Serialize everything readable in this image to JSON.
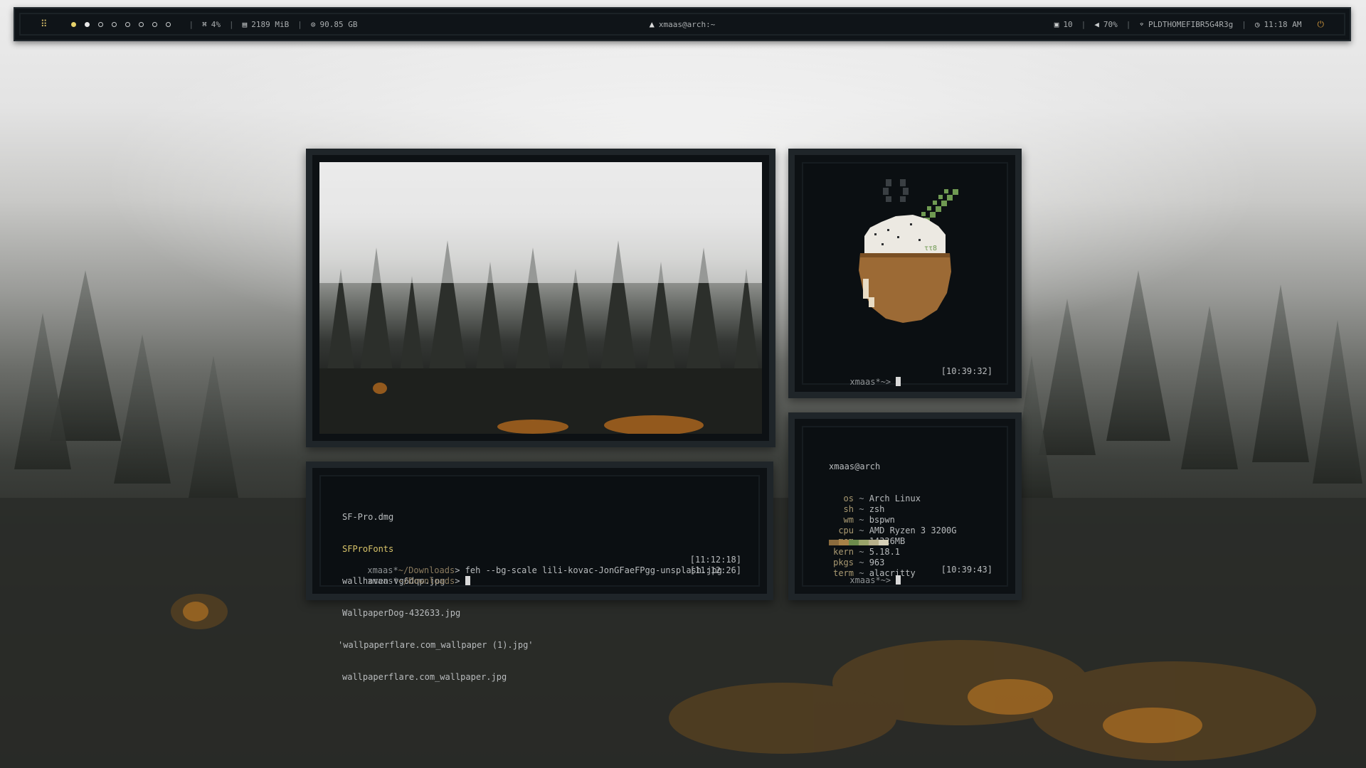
{
  "bar": {
    "launcher_icon": "grid-icon",
    "workspaces": [
      {
        "state": "focused"
      },
      {
        "state": "occupied"
      },
      {
        "state": "empty"
      },
      {
        "state": "empty"
      },
      {
        "state": "empty"
      },
      {
        "state": "empty"
      },
      {
        "state": "empty"
      },
      {
        "state": "empty"
      }
    ],
    "cpu": "4%",
    "memory": "2189 MiB",
    "disk": "90.85 GB",
    "window_title": "xmaas@arch:~",
    "updates": "10",
    "volume": "70%",
    "wifi": "PLDTHOMEFIBR5G4R3g",
    "time": "11:18 AM",
    "separator": "|",
    "colors": {
      "accent": "#e6d26a",
      "power": "#c7903a",
      "bg": "#0f1418"
    }
  },
  "term_files": {
    "lines": [
      {
        "text": "SF-Pro.dmg",
        "style": "normal"
      },
      {
        "text": "SFProFonts",
        "style": "dir"
      },
      {
        "text": "wallhaven-vg6dqp.jpg",
        "style": "normal"
      },
      {
        "text": "WallpaperDog-432633.jpg",
        "style": "normal"
      },
      {
        "text": "'wallpaperflare.com_wallpaper (1).jpg'",
        "style": "normal"
      },
      {
        "text": "wallpaperflare.com_wallpaper.jpg",
        "style": "normal"
      }
    ],
    "prompt_user": "xmaas*",
    "prompt_dir": "~/Downloads",
    "prompt_sym": ">",
    "command": "feh --bg-scale lili-kovac-JonGFaeFPgg-unsplash.jpg",
    "command_time": "[11:12:18]",
    "current_time": "[11:12:26]"
  },
  "term_coco": {
    "prompt": "xmaas*~>",
    "time": "[10:39:32]"
  },
  "term_fetch": {
    "header": "xmaas@arch",
    "rows": [
      {
        "label": "os",
        "value": "Arch Linux"
      },
      {
        "label": "sh",
        "value": "zsh"
      },
      {
        "label": "wm",
        "value": "bspwn"
      },
      {
        "label": "cpu",
        "value": "AMD Ryzen 3 3200G"
      },
      {
        "label": "mem",
        "value": "14326MB"
      },
      {
        "label": "kern",
        "value": "5.18.1"
      },
      {
        "label": "pkgs",
        "value": "963"
      },
      {
        "label": "term",
        "value": "alacritty"
      }
    ],
    "palette": [
      "#8b6b3d",
      "#a88247",
      "#6d8c4c",
      "#9aa46a",
      "#b8b08a",
      "#d6d0b8"
    ],
    "prompt": "xmaas*~>",
    "time": "[10:39:43]"
  }
}
